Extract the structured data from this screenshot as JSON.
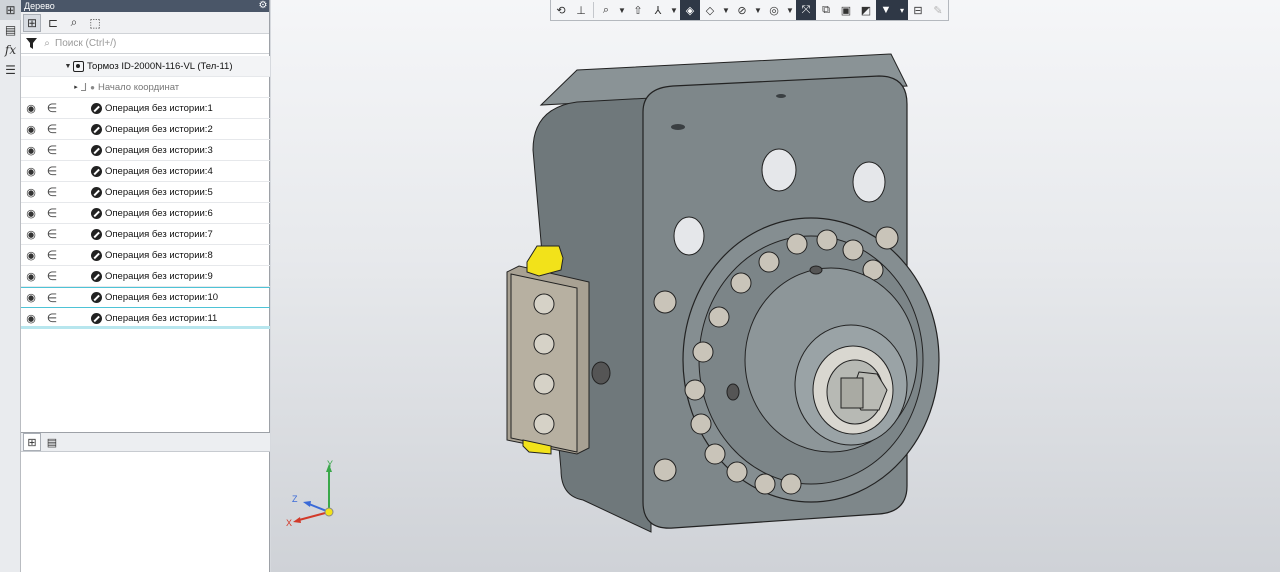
{
  "panel": {
    "title": "Дерево",
    "search_placeholder": "Поиск (Ctrl+/)"
  },
  "tree": {
    "root_label": "Тормоз ID-2000N-116-VL (Тел-11)",
    "origin_label": "Начало координат",
    "operations": [
      "Операция без истории:1",
      "Операция без истории:2",
      "Операция без истории:3",
      "Операция без истории:4",
      "Операция без истории:5",
      "Операция без истории:6",
      "Операция без истории:7",
      "Операция без истории:8",
      "Операция без истории:9",
      "Операция без истории:10",
      "Операция без истории:11"
    ]
  },
  "axes": {
    "x": "X",
    "y": "Y",
    "z": "Z"
  },
  "colors": {
    "title_bar": "#4a5668",
    "selection": "#4ec3d6",
    "model_body": "#7a8386",
    "model_yellow": "#f2e21a",
    "axis_x": "#d23a2a",
    "axis_y": "#3aa84a",
    "axis_z": "#3a6ad8"
  },
  "icons": {
    "vertical_strip": [
      "tree-icon",
      "properties-icon",
      "fx-icon",
      "layers-icon"
    ],
    "panel_tools": [
      "tree-structure-icon",
      "tree-assembly-icon",
      "find-icon",
      "select-icon"
    ],
    "toolbar": [
      "rotate-icon",
      "coordinate-icon",
      "zoom-icon",
      "orient-icon",
      "view-cube-icon",
      "display-icon",
      "hide-icon",
      "section-icon",
      "measure-icon",
      "frame-icon",
      "copy-view-icon",
      "render-icon",
      "filter-icon",
      "clip-icon",
      "eyedropper-icon"
    ]
  }
}
